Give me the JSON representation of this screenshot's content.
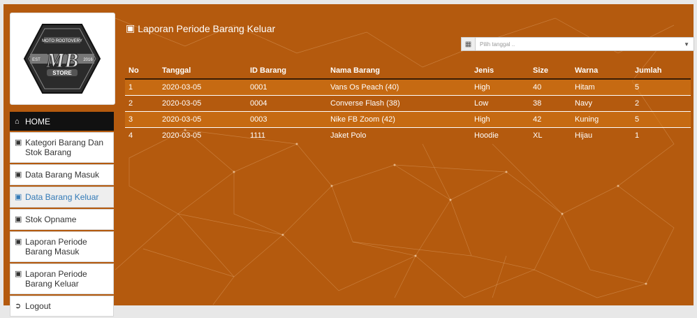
{
  "sidebar": {
    "logo_text_top": "MOTO ROOTOVERY",
    "logo_text_left": "EST",
    "logo_text_right": "2016",
    "logo_mark": "MB",
    "logo_text_bottom": "STORE",
    "items": [
      {
        "label": "HOME",
        "icon": "home-icon"
      },
      {
        "label": "Kategori Barang Dan Stok Barang",
        "icon": "briefcase-icon"
      },
      {
        "label": "Data Barang Masuk",
        "icon": "briefcase-icon"
      },
      {
        "label": "Data Barang Keluar",
        "icon": "briefcase-icon"
      },
      {
        "label": "Stok Opname",
        "icon": "briefcase-icon"
      },
      {
        "label": "Laporan Periode Barang Masuk",
        "icon": "briefcase-icon"
      },
      {
        "label": "Laporan Periode Barang Keluar",
        "icon": "briefcase-icon"
      },
      {
        "label": "Logout",
        "icon": "logout-icon"
      }
    ]
  },
  "header": {
    "title": "Laporan Periode Barang Keluar",
    "date_placeholder": "Pilih tanggal ..",
    "date_icon": "calendar-icon"
  },
  "table": {
    "headers": [
      "No",
      "Tanggal",
      "ID Barang",
      "Nama Barang",
      "Jenis",
      "Size",
      "Warna",
      "Jumlah"
    ],
    "rows": [
      [
        "1",
        "2020-03-05",
        "0001",
        "Vans Os Peach (40)",
        "High",
        "40",
        "Hitam",
        "5"
      ],
      [
        "2",
        "2020-03-05",
        "0004",
        "Converse Flash (38)",
        "Low",
        "38",
        "Navy",
        "2"
      ],
      [
        "3",
        "2020-03-05",
        "0003",
        "Nike FB Zoom (42)",
        "High",
        "42",
        "Kuning",
        "5"
      ],
      [
        "4",
        "2020-03-05",
        "1111",
        "Jaket Polo",
        "Hoodie",
        "XL",
        "Hijau",
        "1"
      ]
    ]
  },
  "colors": {
    "background": "#b45a0e",
    "active_link": "#337ab7",
    "home_bg": "#111111"
  }
}
